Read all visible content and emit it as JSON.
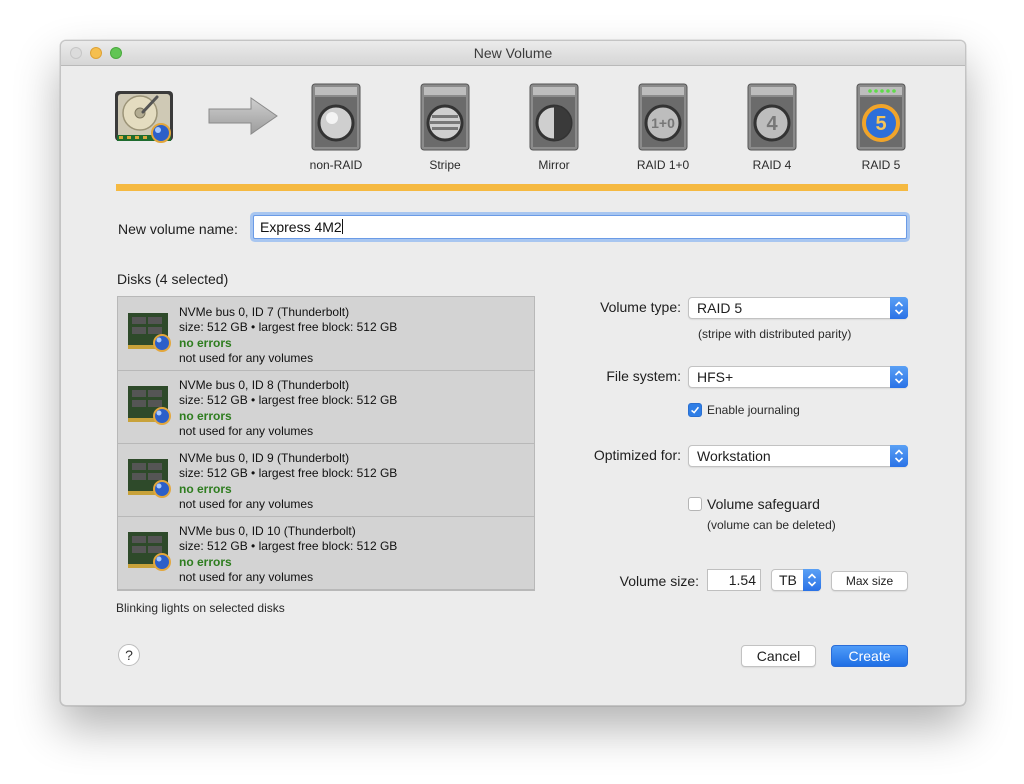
{
  "window": {
    "title": "New Volume"
  },
  "raid_options": [
    {
      "label": "non-RAID",
      "glyph": ""
    },
    {
      "label": "Stripe",
      "glyph": ""
    },
    {
      "label": "Mirror",
      "glyph": ""
    },
    {
      "label": "RAID 1+0",
      "glyph": "1+0"
    },
    {
      "label": "RAID 4",
      "glyph": "4"
    },
    {
      "label": "RAID 5",
      "glyph": "5"
    }
  ],
  "volume_name": {
    "label": "New volume name:",
    "value": "Express 4M2"
  },
  "disks": {
    "header": "Disks (4 selected)",
    "items": [
      {
        "name": "NVMe bus 0, ID 7 (Thunderbolt)",
        "size": "size: 512 GB • largest free block: 512 GB",
        "status": "no errors",
        "usage": "not used for any volumes"
      },
      {
        "name": "NVMe bus 0, ID 8 (Thunderbolt)",
        "size": "size: 512 GB • largest free block: 512 GB",
        "status": "no errors",
        "usage": "not used for any volumes"
      },
      {
        "name": "NVMe bus 0, ID 9 (Thunderbolt)",
        "size": "size: 512 GB • largest free block: 512 GB",
        "status": "no errors",
        "usage": "not used for any volumes"
      },
      {
        "name": "NVMe bus 0, ID 10 (Thunderbolt)",
        "size": "size: 512 GB • largest free block: 512 GB",
        "status": "no errors",
        "usage": "not used for any volumes"
      }
    ],
    "footer": "Blinking lights on selected disks"
  },
  "volume_type": {
    "label": "Volume type:",
    "value": "RAID 5",
    "note": "(stripe with distributed parity)"
  },
  "file_system": {
    "label": "File system:",
    "value": "HFS+",
    "journaling_label": "Enable journaling",
    "journaling_checked": true
  },
  "optimized_for": {
    "label": "Optimized for:",
    "value": "Workstation"
  },
  "safeguard": {
    "label": "Volume safeguard",
    "note": "(volume can be deleted)",
    "checked": false
  },
  "volume_size": {
    "label": "Volume size:",
    "value": "1.54",
    "unit": "TB",
    "max_label": "Max size"
  },
  "buttons": {
    "help": "?",
    "cancel": "Cancel",
    "create": "Create"
  },
  "colors": {
    "accent": "#f5b941",
    "primary_button": "#2a72e6",
    "ok_status": "#2e7d1f"
  }
}
